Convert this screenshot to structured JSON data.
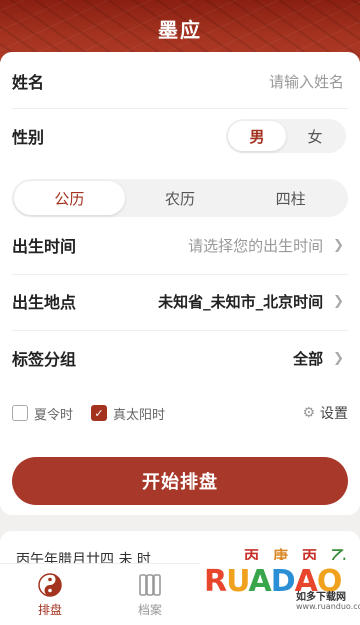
{
  "header": {
    "title": "墨应"
  },
  "form": {
    "name": {
      "label": "姓名",
      "placeholder": "请输入姓名"
    },
    "gender": {
      "label": "性别",
      "options": [
        "男",
        "女"
      ],
      "selected": "男"
    },
    "calendar_tabs": [
      "公历",
      "农历",
      "四柱"
    ],
    "calendar_selected": "公历",
    "birth_time": {
      "label": "出生时间",
      "placeholder": "请选择您的出生时间"
    },
    "birth_place": {
      "label": "出生地点",
      "value": "未知省_未知市_北京时间"
    },
    "tag_group": {
      "label": "标签分组",
      "value": "全部"
    },
    "daylight_saving": {
      "label": "夏令时",
      "checked": false
    },
    "true_solar": {
      "label": "真太阳时",
      "checked": true
    },
    "settings_label": "设置",
    "start_button": "开始排盘"
  },
  "record": {
    "date": "丙午年腊月廿四 未 时",
    "pillars": [
      "丙",
      "庚",
      "丙",
      "乙"
    ]
  },
  "tabbar": [
    {
      "label": "排盘",
      "icon": "yin-yang-icon",
      "active": true
    },
    {
      "label": "档案",
      "icon": "archive-icon",
      "active": false
    }
  ],
  "watermark": {
    "logo": "RUANDAO",
    "cn": "如多下载网",
    "url": "www.ruanduo.com"
  },
  "colors": {
    "accent": "#a3321f",
    "button": "#a8392a"
  }
}
